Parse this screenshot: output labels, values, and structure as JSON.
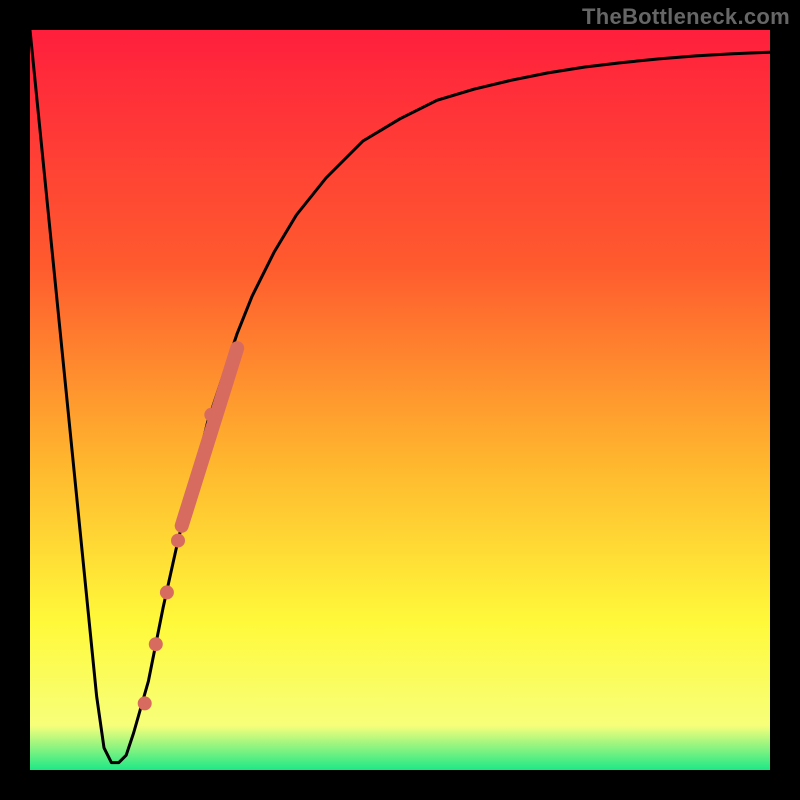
{
  "watermark": "TheBottleneck.com",
  "colors": {
    "frame": "#000000",
    "gradient_top": "#ff1f3d",
    "gradient_mid1": "#ff5b2e",
    "gradient_mid2": "#ffb52e",
    "gradient_mid3": "#fff93a",
    "gradient_bottom_band": "#f7ff7a",
    "gradient_bottom": "#1ee886",
    "curve": "#000000",
    "marker": "#d86b60"
  },
  "chart_data": {
    "type": "line",
    "title": "",
    "xlabel": "",
    "ylabel": "",
    "xlim": [
      0,
      100
    ],
    "ylim": [
      0,
      100
    ],
    "series": [
      {
        "name": "bottleneck-curve",
        "x": [
          0,
          2,
          4,
          6,
          8,
          9,
          10,
          11,
          12,
          13,
          14,
          16,
          18,
          20,
          22,
          24,
          26,
          28,
          30,
          33,
          36,
          40,
          45,
          50,
          55,
          60,
          65,
          70,
          75,
          80,
          85,
          90,
          95,
          100
        ],
        "y": [
          100,
          80,
          60,
          40,
          20,
          10,
          3,
          1,
          1,
          2,
          5,
          12,
          22,
          31,
          39,
          47,
          53,
          59,
          64,
          70,
          75,
          80,
          85,
          88,
          90.5,
          92,
          93.2,
          94.2,
          95,
          95.6,
          96.1,
          96.5,
          96.8,
          97
        ]
      }
    ],
    "markers": {
      "name": "highlight-points",
      "points": [
        {
          "x": 15.5,
          "y": 9
        },
        {
          "x": 17.0,
          "y": 17
        },
        {
          "x": 18.5,
          "y": 24
        },
        {
          "x": 20.0,
          "y": 31
        },
        {
          "x": 24.5,
          "y": 48
        }
      ],
      "bar": {
        "x1": 20.5,
        "y1": 33,
        "x2": 28.0,
        "y2": 57
      }
    }
  }
}
